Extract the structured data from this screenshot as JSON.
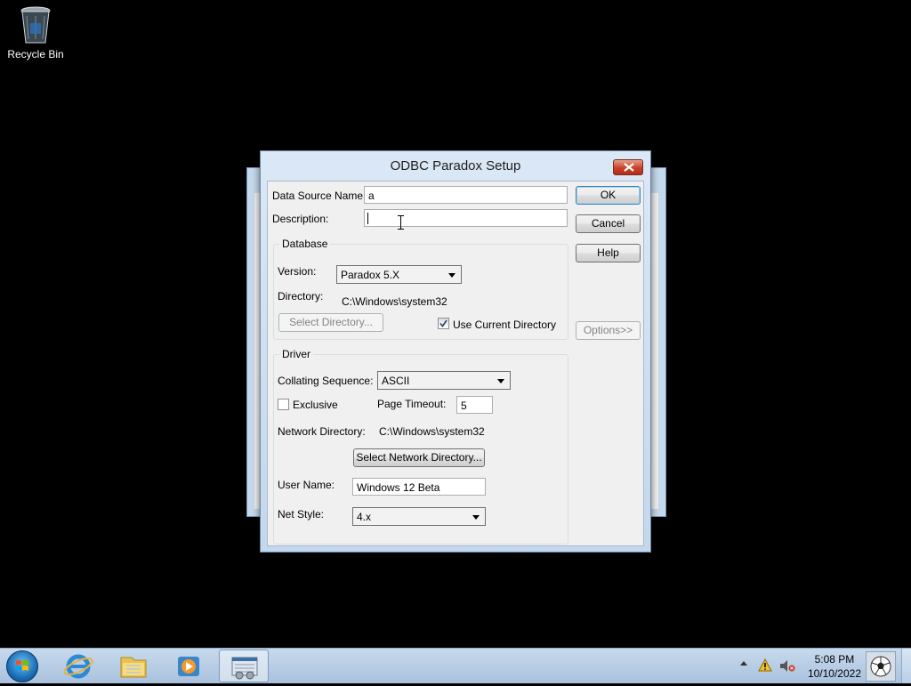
{
  "desktop": {
    "recycle_bin_label": "Recycle Bin"
  },
  "dialog": {
    "title": "ODBC Paradox Setup",
    "data_source_name_label": "Data Source Name:",
    "data_source_name_value": "a",
    "description_label": "Description:",
    "description_value": "",
    "ok_label": "OK",
    "cancel_label": "Cancel",
    "help_label": "Help",
    "options_label": "Options>>",
    "database": {
      "group_label": "Database",
      "version_label": "Version:",
      "version_value": "Paradox 5.X",
      "directory_label": "Directory:",
      "directory_value": "C:\\Windows\\system32",
      "select_directory_label": "Select Directory...",
      "use_current_directory_label": "Use Current Directory",
      "use_current_directory_checked": true
    },
    "driver": {
      "group_label": "Driver",
      "collating_label": "Collating Sequence:",
      "collating_value": "ASCII",
      "exclusive_label": "Exclusive",
      "exclusive_checked": false,
      "page_timeout_label": "Page Timeout:",
      "page_timeout_value": "5",
      "network_directory_label": "Network Directory:",
      "network_directory_value": "C:\\Windows\\system32",
      "select_network_directory_label": "Select Network Directory...",
      "user_name_label": "User Name:",
      "user_name_value": "Windows 12 Beta",
      "net_style_label": "Net Style:",
      "net_style_value": "4.x"
    }
  },
  "taskbar": {
    "clock_time": "5:08 PM",
    "clock_date": "10/10/2022"
  },
  "colors": {
    "taskbar": "#b8cde6",
    "close_button": "#c7412a",
    "dialog_frame": "#c3d7ed"
  }
}
